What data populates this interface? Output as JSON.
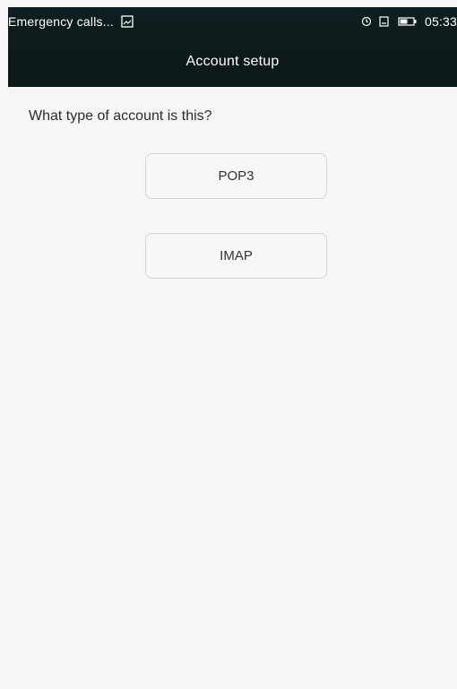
{
  "status_bar": {
    "left_text": "Emergency calls...",
    "time": "05:33",
    "icons": {
      "image": "image-icon",
      "alarm": "alarm-icon",
      "sim": "sim-icon",
      "battery": "battery-icon"
    }
  },
  "header": {
    "title": "Account setup"
  },
  "main": {
    "prompt": "What type of account is this?",
    "buttons": [
      {
        "label": "POP3"
      },
      {
        "label": "IMAP"
      }
    ]
  }
}
